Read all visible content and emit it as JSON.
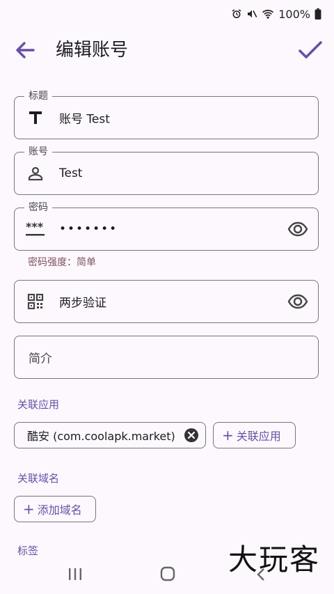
{
  "status": {
    "battery": "100%"
  },
  "header": {
    "title": "编辑账号"
  },
  "fields": {
    "title": {
      "label": "标题",
      "value": "账号 Test"
    },
    "account": {
      "label": "账号",
      "value": "Test"
    },
    "password": {
      "label": "密码",
      "value": "•••••••",
      "helper": "密码强度：简单"
    },
    "two_step": {
      "value": "两步验证"
    },
    "intro": {
      "placeholder": "简介"
    }
  },
  "apps": {
    "title": "关联应用",
    "items": [
      {
        "label": "酷安 (com.coolapk.market)"
      }
    ],
    "add_label": "关联应用"
  },
  "domains": {
    "title": "关联域名",
    "add_label": "添加域名"
  },
  "tags": {
    "title": "标签"
  },
  "colors": {
    "accent": "#6750a4",
    "outline": "#79747e",
    "background": "#fdf8fd",
    "helper": "#7d5260"
  },
  "watermark": "大玩客"
}
